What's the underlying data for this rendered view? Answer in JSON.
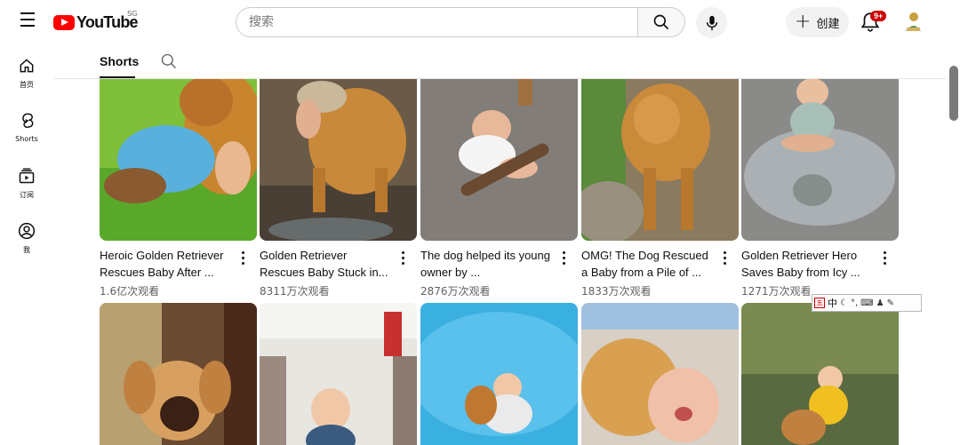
{
  "header": {
    "logo_text": "YouTube",
    "region": "SG",
    "search_placeholder": "搜索",
    "create_label": "创建",
    "notification_count": "9+"
  },
  "sidebar": {
    "items": [
      {
        "label": "首页",
        "icon": "home-icon"
      },
      {
        "label": "Shorts",
        "icon": "shorts-icon"
      },
      {
        "label": "订阅",
        "icon": "subscriptions-icon"
      },
      {
        "label": "我",
        "icon": "profile-icon"
      }
    ]
  },
  "tabs": {
    "active_label": "Shorts"
  },
  "shorts_row1": [
    {
      "title": "Heroic Golden Retriever Rescues Baby After ...",
      "views": "1.6亿次观看"
    },
    {
      "title": "Golden Retriever Rescues Baby Stuck in...",
      "views": "8311万次观看"
    },
    {
      "title": "The dog helped its young owner by ...",
      "views": "2876万次观看"
    },
    {
      "title": "OMG!  The Dog Rescued a Baby from a Pile of ...",
      "views": "1833万次观看"
    },
    {
      "title": "Golden Retriever Hero Saves Baby from Icy ...",
      "views": "1271万次观看"
    }
  ],
  "ime_toolbar": {
    "mode": "中",
    "icon_label": "五"
  },
  "colors": {
    "brand_red": "#ff0000",
    "badge_red": "#cc0000"
  }
}
